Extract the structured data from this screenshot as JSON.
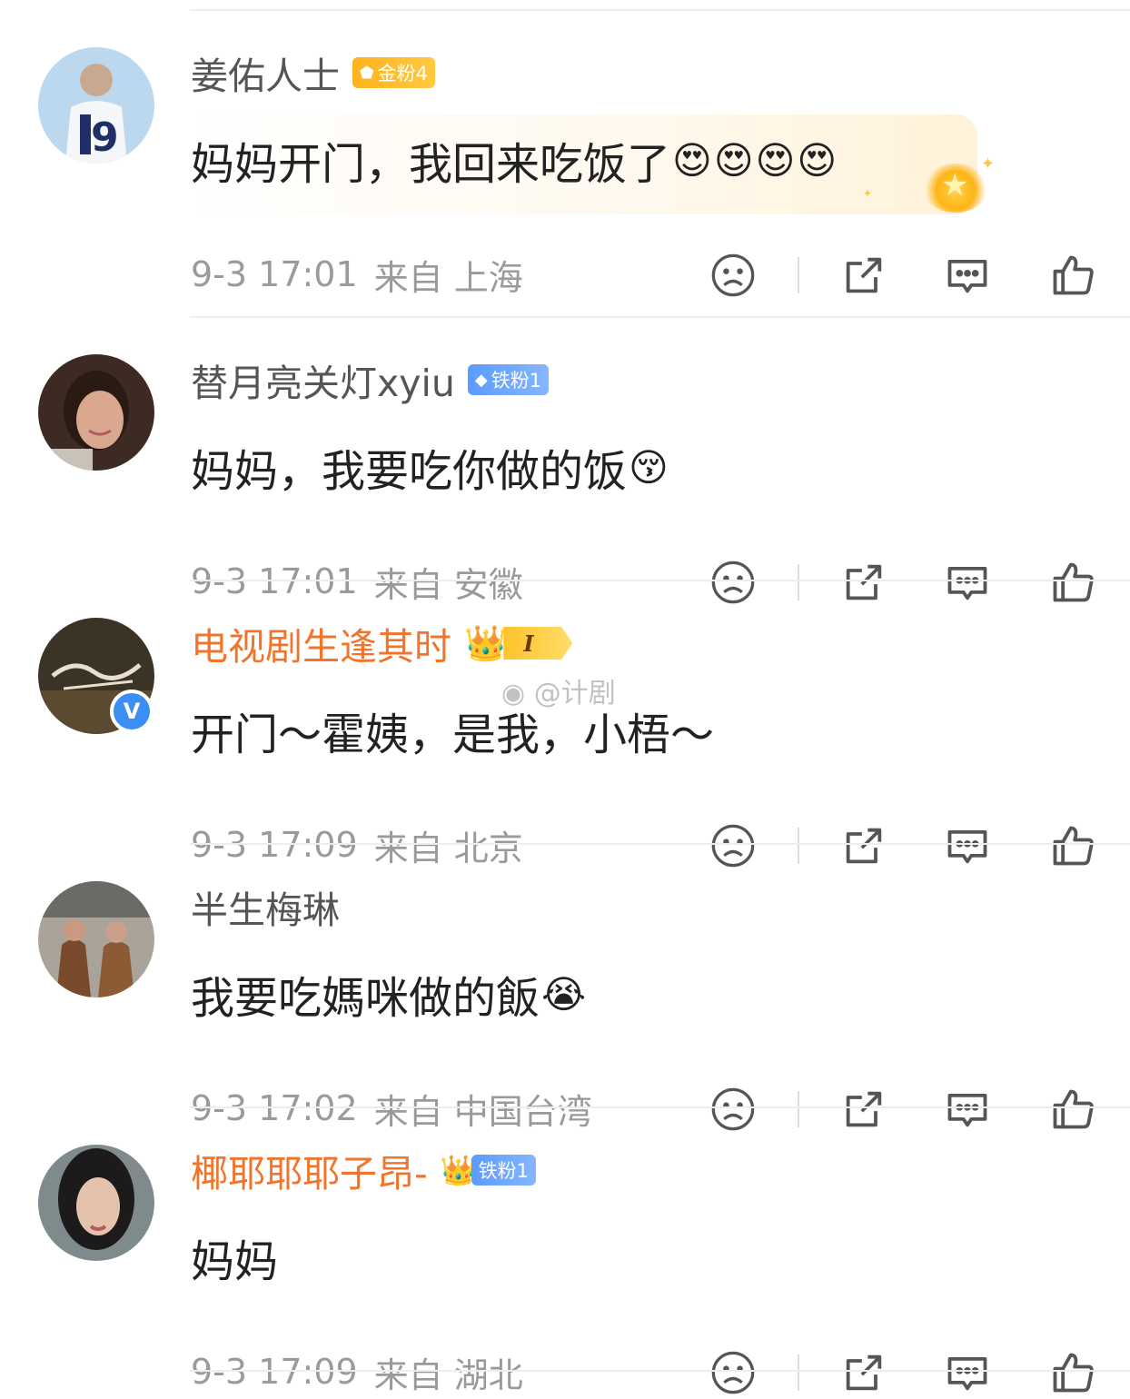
{
  "comments": [
    {
      "username": "姜佑人士",
      "badge": "金粉4",
      "text": "妈妈开门，我回来吃饭了",
      "emojis": [
        "😍",
        "😍",
        "😍",
        "😍"
      ],
      "time": "9-3 17:01",
      "from": "来自 上海"
    },
    {
      "username": "替月亮关灯xyiu",
      "badge": "铁粉1",
      "text": "妈妈，我要吃你做的饭",
      "emojis": [
        "😚"
      ],
      "time": "9-3 17:01",
      "from": "来自 安徽"
    },
    {
      "username": "电视剧生逢其时",
      "badge": "I",
      "text": "开门～霍姨，是我，小梧～",
      "emojis": [],
      "time": "9-3 17:09",
      "from": "来自 北京"
    },
    {
      "username": "半生梅琳",
      "badge": "",
      "text": "我要吃媽咪做的飯",
      "emojis": [
        "😭"
      ],
      "time": "9-3 17:02",
      "from": "来自 中国台湾"
    },
    {
      "username": "椰耶耶耶子昂-",
      "badge": "铁粉1",
      "text": "妈妈",
      "emojis": [],
      "time": "9-3 17:09",
      "from": "来自 湖北"
    }
  ],
  "watermark": "@计剧",
  "icons": {
    "dislike": "sad-face-icon",
    "share": "share-icon",
    "reply": "comment-icon",
    "like": "thumbs-up-icon",
    "verified": "verified-v-icon"
  },
  "colors": {
    "username_default": "#555555",
    "username_vip": "#f1742a",
    "meta_text": "#9a9a9a",
    "gold_badge": "#ffb21e",
    "iron_badge": "#5b9bff",
    "verified": "#3b8ef3"
  }
}
